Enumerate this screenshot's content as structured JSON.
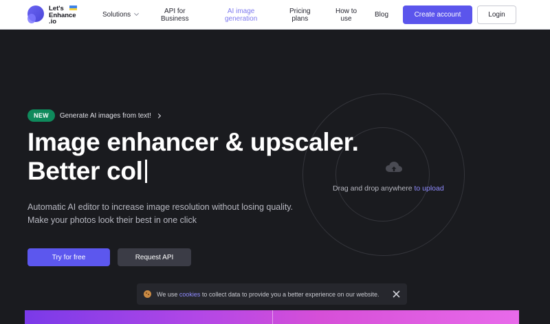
{
  "header": {
    "logo_text": "Let's\nEnhance\n.io",
    "nav": {
      "solutions": "Solutions",
      "api": "API for\nBusiness",
      "ai_generation": "AI image\ngeneration",
      "pricing": "Pricing\nplans",
      "how_to": "How to\nuse",
      "blog": "Blog"
    },
    "create_account": "Create account",
    "login": "Login"
  },
  "hero": {
    "badge_new": "NEW",
    "badge_text": "Generate AI images from text!",
    "headline_line1": "Image enhancer & upscaler.",
    "headline_line2": "Better col",
    "subtitle_line1": "Automatic AI editor to increase image resolution without losing quality.",
    "subtitle_line2": "Make your photos look their best in one click",
    "try_button": "Try for free",
    "api_button": "Request API",
    "drop_text": "Drag and drop anywhere",
    "drop_link": "to upload"
  },
  "cookie_bar": {
    "text_before": "We use",
    "link": "cookies",
    "text_after": "to collect data to provide you a better experience on our website."
  },
  "colors": {
    "accent": "#5b55ec",
    "background": "#1a1b1f",
    "new_badge": "#0f8a5c",
    "link": "#8f8bff"
  }
}
